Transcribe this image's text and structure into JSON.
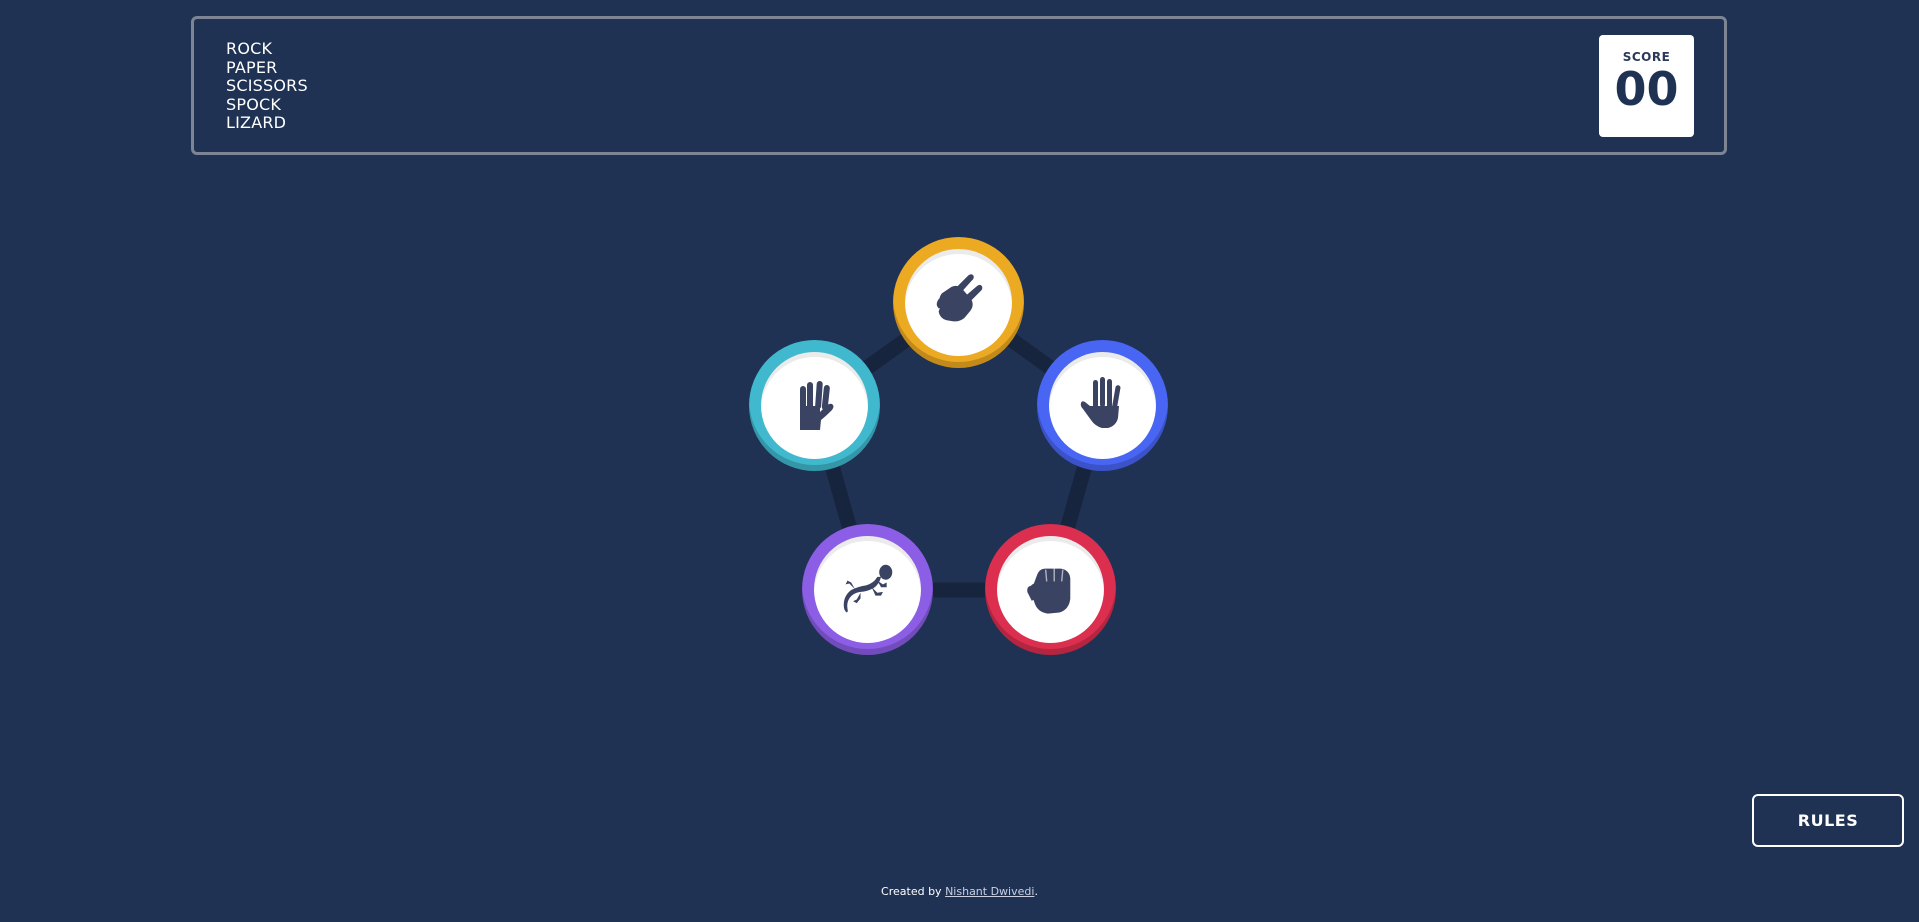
{
  "header": {
    "title_lines": [
      "ROCK",
      "PAPER",
      "SCISSORS",
      "SPOCK",
      "LIZARD"
    ],
    "score_label": "SCORE",
    "score_value": "00"
  },
  "tokens": [
    {
      "name": "scissors",
      "icon": "scissors-hand-icon",
      "color": "#eca922"
    },
    {
      "name": "paper",
      "icon": "paper-hand-icon",
      "color": "#4865f4"
    },
    {
      "name": "rock",
      "icon": "rock-fist-icon",
      "color": "#dc2e4e"
    },
    {
      "name": "lizard",
      "icon": "lizard-icon",
      "color": "#8c5de5"
    },
    {
      "name": "spock",
      "icon": "spock-hand-icon",
      "color": "#40b9ce"
    }
  ],
  "rules_button": "RULES",
  "footer": {
    "prefix": "Created by ",
    "author": "Nishant Dwivedi",
    "suffix": "."
  },
  "colors": {
    "background": "#1f3254",
    "pentagon_lines": "#17243d",
    "icon_fill": "#3b4363"
  }
}
